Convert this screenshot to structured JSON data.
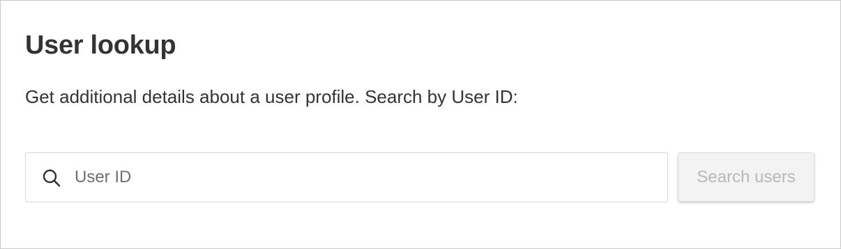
{
  "page": {
    "title": "User lookup",
    "description": "Get additional details about a user profile. Search by User ID:"
  },
  "search": {
    "placeholder": "User ID",
    "value": "",
    "icon": "search-icon",
    "button_label": "Search users",
    "button_state": "disabled"
  },
  "colors": {
    "text": "#333333",
    "placeholder": "#6f6f6f",
    "border": "#d6d6d6",
    "button_bg": "#f3f3f3",
    "button_text_disabled": "#b8b8b8"
  }
}
